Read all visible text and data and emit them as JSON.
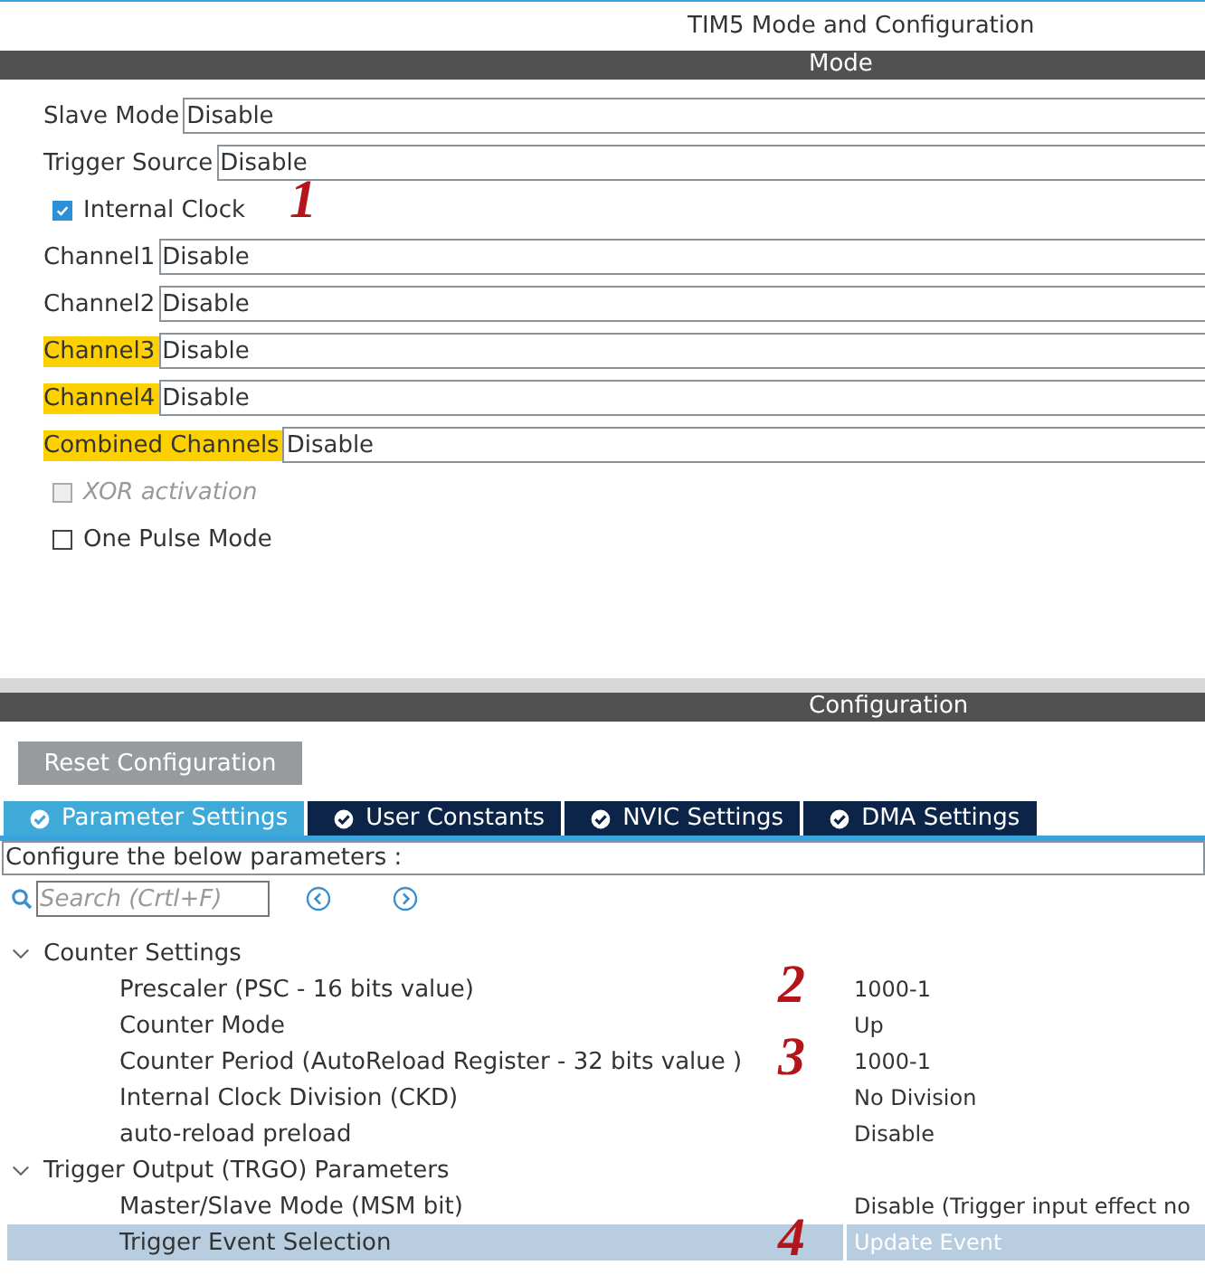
{
  "window": {
    "title": "TIM5 Mode and Configuration"
  },
  "mode": {
    "heading": "Mode",
    "rows": [
      {
        "kind": "select",
        "label": "Slave Mode",
        "value": "Disable",
        "highlighted": false
      },
      {
        "kind": "select",
        "label": "Trigger Source",
        "value": "Disable",
        "highlighted": false
      },
      {
        "kind": "checkbox",
        "label": "Internal Clock",
        "checked": true,
        "disabled": false,
        "annotation": "1"
      },
      {
        "kind": "select",
        "label": "Channel1",
        "value": "Disable",
        "highlighted": false
      },
      {
        "kind": "select",
        "label": "Channel2",
        "value": "Disable",
        "highlighted": false
      },
      {
        "kind": "select",
        "label": "Channel3",
        "value": "Disable",
        "highlighted": true
      },
      {
        "kind": "select",
        "label": "Channel4",
        "value": "Disable",
        "highlighted": true
      },
      {
        "kind": "select",
        "label": "Combined Channels",
        "value": "Disable",
        "highlighted": true
      },
      {
        "kind": "checkbox",
        "label": "XOR activation",
        "checked": false,
        "disabled": true
      },
      {
        "kind": "checkbox",
        "label": "One Pulse Mode",
        "checked": false,
        "disabled": false
      }
    ]
  },
  "configuration": {
    "heading": "Configuration",
    "reset_button": "Reset Configuration",
    "tabs": [
      {
        "label": "Parameter Settings",
        "selected": true
      },
      {
        "label": "User Constants",
        "selected": false
      },
      {
        "label": "NVIC Settings",
        "selected": false
      },
      {
        "label": "DMA Settings",
        "selected": false
      }
    ],
    "instruction": "Configure the below parameters :",
    "search": {
      "placeholder": "Search (Crtl+F)"
    },
    "tree": [
      {
        "label": "Counter Settings",
        "expanded": true,
        "children": [
          {
            "label": "Prescaler (PSC - 16 bits value)",
            "value": "1000-1",
            "selected": false,
            "annotation": "2"
          },
          {
            "label": "Counter Mode",
            "value": "Up",
            "selected": false
          },
          {
            "label": "Counter Period (AutoReload Register - 32 bits value )",
            "value": "1000-1",
            "selected": false,
            "annotation": "3"
          },
          {
            "label": "Internal Clock Division (CKD)",
            "value": "No Division",
            "selected": false
          },
          {
            "label": "auto-reload preload",
            "value": "Disable",
            "selected": false
          }
        ]
      },
      {
        "label": "Trigger Output (TRGO) Parameters",
        "expanded": true,
        "children": [
          {
            "label": "Master/Slave Mode (MSM bit)",
            "value": "Disable (Trigger input effect no",
            "selected": false
          },
          {
            "label": "Trigger Event Selection",
            "value": "Update Event",
            "selected": true,
            "annotation": "4"
          }
        ]
      }
    ]
  }
}
